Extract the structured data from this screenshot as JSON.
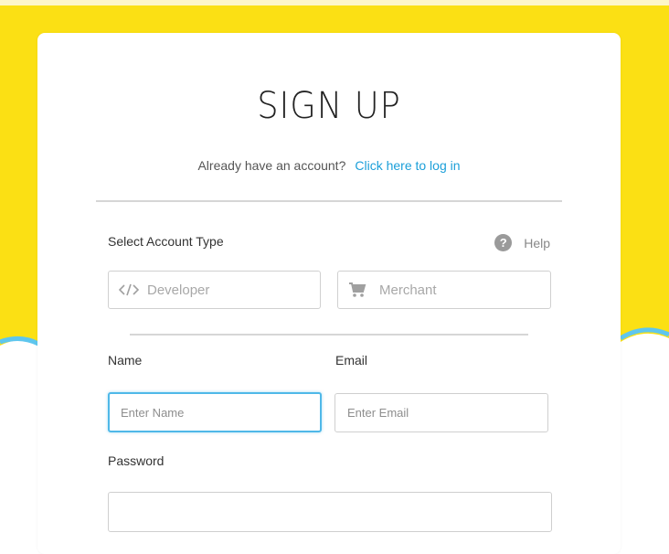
{
  "page": {
    "title": "SIGN UP",
    "login_prompt": "Already have an account?",
    "login_link": "Click here to log in"
  },
  "account_type": {
    "label": "Select Account Type",
    "help_label": "Help",
    "options": [
      {
        "label": "Developer",
        "icon": "code-icon"
      },
      {
        "label": "Merchant",
        "icon": "cart-icon"
      }
    ]
  },
  "form": {
    "name_label": "Name",
    "name_placeholder": "Enter Name",
    "email_label": "Email",
    "email_placeholder": "Enter Email",
    "password_label": "Password",
    "password_value": ""
  },
  "colors": {
    "background_yellow": "#fbe014",
    "wave_blue": "#5ec6ee",
    "link_blue": "#1b9fd9",
    "focus_border": "#4fb8e8"
  }
}
